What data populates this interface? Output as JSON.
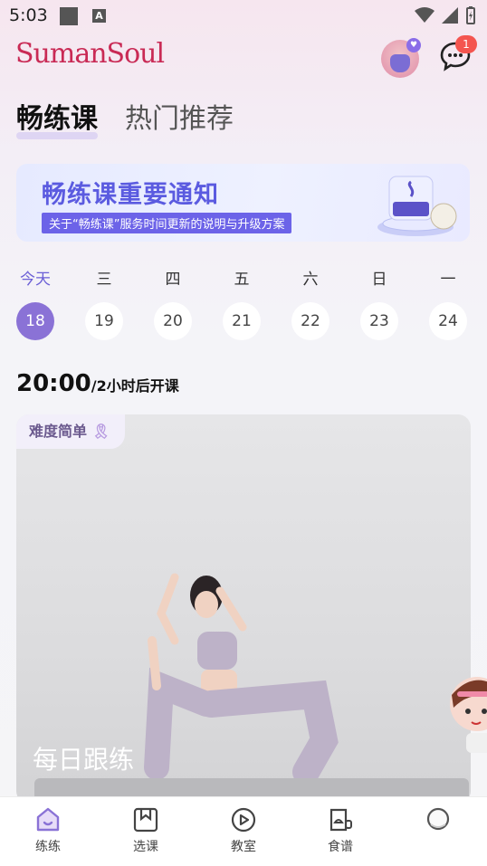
{
  "status_bar": {
    "time": "5:03"
  },
  "header": {
    "logo": "SumanSoul",
    "message_badge": "1"
  },
  "tabs": [
    {
      "label": "畅练课",
      "active": true
    },
    {
      "label": "热门推荐",
      "active": false
    }
  ],
  "banner": {
    "title": "畅练课重要通知",
    "subtitle": "关于“畅练课”服务时间更新的说明与升级方案"
  },
  "week": [
    {
      "label": "今天",
      "date": "18",
      "selected": true
    },
    {
      "label": "三",
      "date": "19"
    },
    {
      "label": "四",
      "date": "20"
    },
    {
      "label": "五",
      "date": "21"
    },
    {
      "label": "六",
      "date": "22"
    },
    {
      "label": "日",
      "date": "23"
    },
    {
      "label": "一",
      "date": "24"
    }
  ],
  "class": {
    "time": "20:00",
    "countdown": "/2小时后开课",
    "difficulty": "难度简单",
    "caption": "每日跟练"
  },
  "bottom_nav": [
    {
      "label": "练练",
      "icon": "home-icon",
      "active": true
    },
    {
      "label": "选课",
      "icon": "bookmark-icon"
    },
    {
      "label": "教室",
      "icon": "play-icon"
    },
    {
      "label": "食谱",
      "icon": "recipe-icon"
    },
    {
      "label": "",
      "icon": "profile-icon"
    }
  ],
  "colors": {
    "accent": "#8a72d6",
    "brand": "#c92a55",
    "badge": "#f4554f"
  }
}
